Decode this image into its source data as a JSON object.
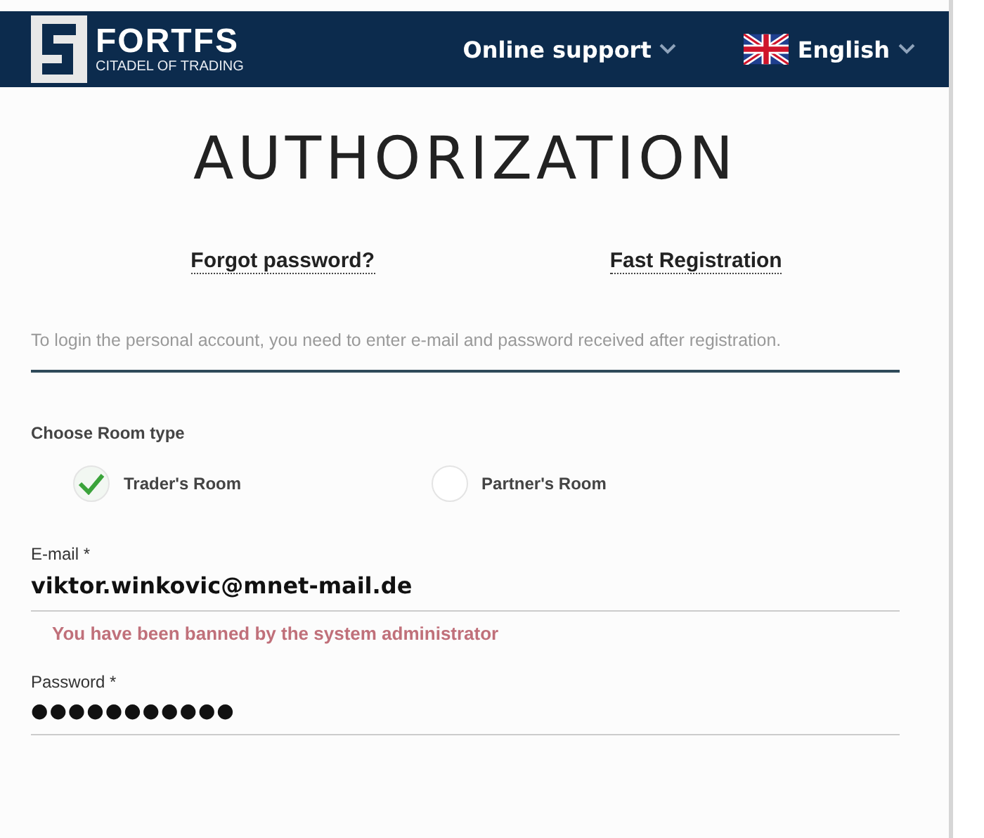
{
  "header": {
    "logo_name": "FORTFS",
    "logo_tagline": "CITADEL OF TRADING",
    "support": "Online support",
    "language": "English"
  },
  "title": "AUTHORIZATION",
  "links": [
    "Forgot password?",
    "Fast Registration"
  ],
  "intro": "To login the personal account, you need to enter e-mail and password received after registration.",
  "room_type": {
    "label": "Choose Room type",
    "options": [
      {
        "label": "Trader's Room",
        "selected": true
      },
      {
        "label": "Partner's Room",
        "selected": false
      }
    ]
  },
  "fields": [
    {
      "kind": "email",
      "label": "E-mail *",
      "value": "viktor.winkovic@mnet-mail.de",
      "error": "You have been banned by the system administrator"
    },
    {
      "kind": "password",
      "label": "Password *",
      "value": "●●●●●●●●●●●"
    }
  ]
}
